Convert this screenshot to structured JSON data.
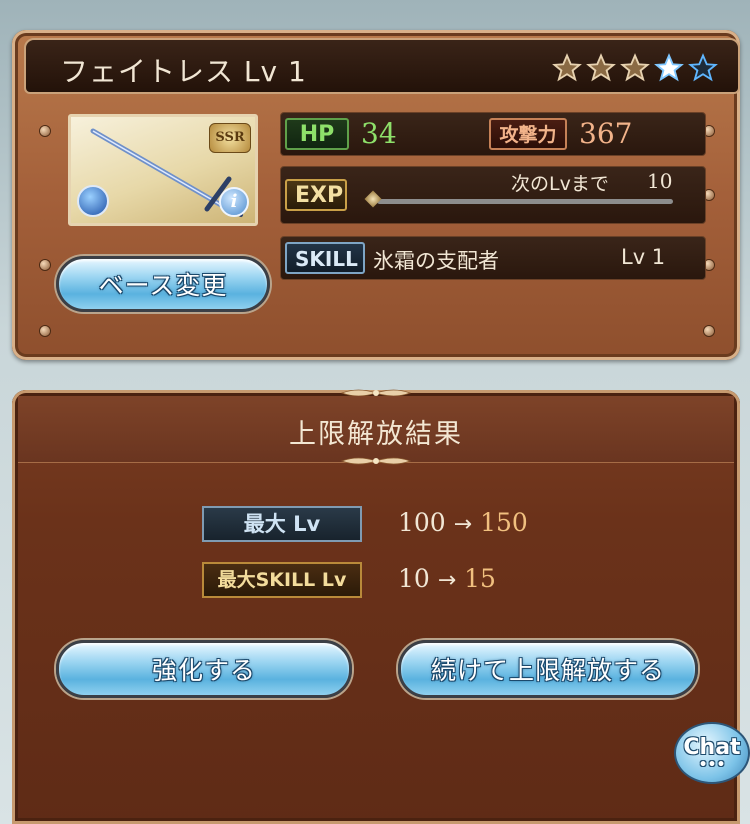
{
  "weapon": {
    "name": "フェイトレス Lv 1",
    "rarity_badge": "SSR",
    "uncap_stars_filled": 3,
    "uncap_stars_total": 5,
    "hp_label": "HP",
    "hp_value": "34",
    "atk_label": "攻撃力",
    "atk_value": "367",
    "exp_label": "EXP",
    "next_lv_text": "次のLvまで",
    "next_lv_value": "10",
    "exp_progress": 0,
    "skill_label": "SKILL",
    "skill_name": "氷霜の支配者",
    "skill_level": "Lv 1",
    "base_change_button": "ベース変更"
  },
  "result": {
    "title": "上限解放結果",
    "max_lv_label": "最大 Lv",
    "max_lv_from": "100",
    "max_lv_to": "150",
    "max_skill_label": "最大SKILL Lv",
    "max_skill_from": "10",
    "max_skill_to": "15",
    "arrow": "→",
    "enhance_button": "強化する",
    "continue_button": "続けて上限解放する"
  },
  "chat": {
    "label": "Chat",
    "dots": "•••"
  },
  "colors": {
    "hp": "#8ee06a",
    "atk": "#f2b38a",
    "new_value": "#f1c07f"
  },
  "icons": [
    "star-icon",
    "water-element-icon",
    "info-icon",
    "ornament-icon",
    "chat-bubble-icon"
  ]
}
